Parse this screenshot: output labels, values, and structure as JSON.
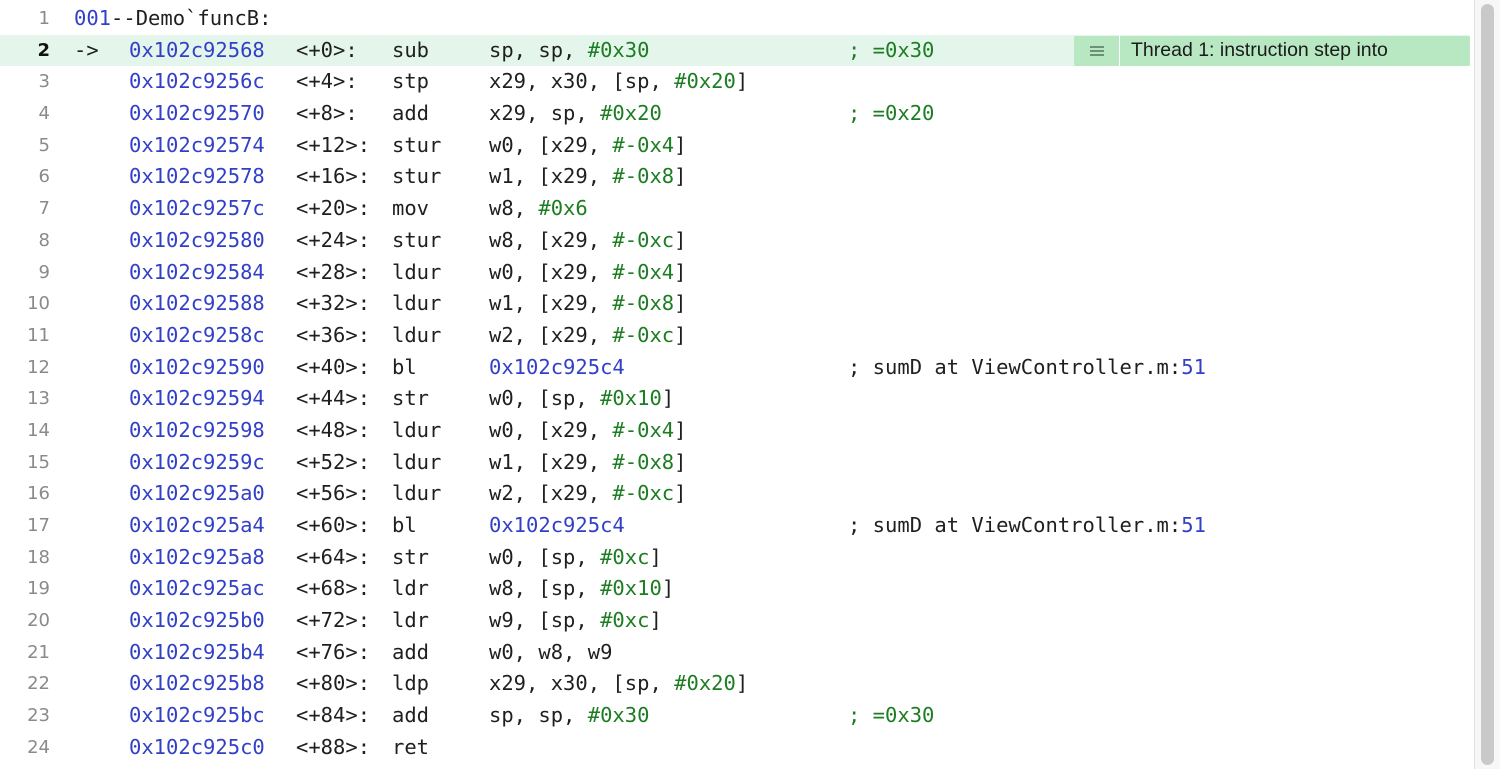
{
  "header": {
    "func_num": "001",
    "func_rest": "--Demo`funcB:"
  },
  "badge": {
    "icon": "list-lines-icon",
    "text": "Thread 1: instruction step into"
  },
  "pc_arrow": "->",
  "lines": [
    {
      "n": "1"
    },
    {
      "n": "2",
      "addr": "0x102c92568",
      "off": "<+0>:",
      "mn": "sub",
      "ops": [
        {
          "t": "sp, sp, "
        },
        {
          "t": "#0x30",
          "c": "num"
        }
      ],
      "cmt": "; =0x30"
    },
    {
      "n": "3",
      "addr": "0x102c9256c",
      "off": "<+4>:",
      "mn": "stp",
      "ops": [
        {
          "t": "x29, x30, [sp, "
        },
        {
          "t": "#0x20",
          "c": "num"
        },
        {
          "t": "]"
        }
      ]
    },
    {
      "n": "4",
      "addr": "0x102c92570",
      "off": "<+8>:",
      "mn": "add",
      "ops": [
        {
          "t": "x29, sp, "
        },
        {
          "t": "#0x20",
          "c": "num"
        }
      ],
      "cmt": "; =0x20"
    },
    {
      "n": "5",
      "addr": "0x102c92574",
      "off": "<+12>:",
      "mn": "stur",
      "ops": [
        {
          "t": "w0, [x29, "
        },
        {
          "t": "#-0x4",
          "c": "num"
        },
        {
          "t": "]"
        }
      ]
    },
    {
      "n": "6",
      "addr": "0x102c92578",
      "off": "<+16>:",
      "mn": "stur",
      "ops": [
        {
          "t": "w1, [x29, "
        },
        {
          "t": "#-0x8",
          "c": "num"
        },
        {
          "t": "]"
        }
      ]
    },
    {
      "n": "7",
      "addr": "0x102c9257c",
      "off": "<+20>:",
      "mn": "mov",
      "ops": [
        {
          "t": "w8, "
        },
        {
          "t": "#0x6",
          "c": "num"
        }
      ]
    },
    {
      "n": "8",
      "addr": "0x102c92580",
      "off": "<+24>:",
      "mn": "stur",
      "ops": [
        {
          "t": "w8, [x29, "
        },
        {
          "t": "#-0xc",
          "c": "num"
        },
        {
          "t": "]"
        }
      ]
    },
    {
      "n": "9",
      "addr": "0x102c92584",
      "off": "<+28>:",
      "mn": "ldur",
      "ops": [
        {
          "t": "w0, [x29, "
        },
        {
          "t": "#-0x4",
          "c": "num"
        },
        {
          "t": "]"
        }
      ]
    },
    {
      "n": "10",
      "addr": "0x102c92588",
      "off": "<+32>:",
      "mn": "ldur",
      "ops": [
        {
          "t": "w1, [x29, "
        },
        {
          "t": "#-0x8",
          "c": "num"
        },
        {
          "t": "]"
        }
      ]
    },
    {
      "n": "11",
      "addr": "0x102c9258c",
      "off": "<+36>:",
      "mn": "ldur",
      "ops": [
        {
          "t": "w2, [x29, "
        },
        {
          "t": "#-0xc",
          "c": "num"
        },
        {
          "t": "]"
        }
      ]
    },
    {
      "n": "12",
      "addr": "0x102c92590",
      "off": "<+40>:",
      "mn": "bl",
      "ops": [
        {
          "t": "0x102c925c4",
          "c": "lnk"
        }
      ],
      "sym": "; sumD at ViewController.m:",
      "symline": "51"
    },
    {
      "n": "13",
      "addr": "0x102c92594",
      "off": "<+44>:",
      "mn": "str",
      "ops": [
        {
          "t": "w0, [sp, "
        },
        {
          "t": "#0x10",
          "c": "num"
        },
        {
          "t": "]"
        }
      ]
    },
    {
      "n": "14",
      "addr": "0x102c92598",
      "off": "<+48>:",
      "mn": "ldur",
      "ops": [
        {
          "t": "w0, [x29, "
        },
        {
          "t": "#-0x4",
          "c": "num"
        },
        {
          "t": "]"
        }
      ]
    },
    {
      "n": "15",
      "addr": "0x102c9259c",
      "off": "<+52>:",
      "mn": "ldur",
      "ops": [
        {
          "t": "w1, [x29, "
        },
        {
          "t": "#-0x8",
          "c": "num"
        },
        {
          "t": "]"
        }
      ]
    },
    {
      "n": "16",
      "addr": "0x102c925a0",
      "off": "<+56>:",
      "mn": "ldur",
      "ops": [
        {
          "t": "w2, [x29, "
        },
        {
          "t": "#-0xc",
          "c": "num"
        },
        {
          "t": "]"
        }
      ]
    },
    {
      "n": "17",
      "addr": "0x102c925a4",
      "off": "<+60>:",
      "mn": "bl",
      "ops": [
        {
          "t": "0x102c925c4",
          "c": "lnk"
        }
      ],
      "sym": "; sumD at ViewController.m:",
      "symline": "51"
    },
    {
      "n": "18",
      "addr": "0x102c925a8",
      "off": "<+64>:",
      "mn": "str",
      "ops": [
        {
          "t": "w0, [sp, "
        },
        {
          "t": "#0xc",
          "c": "num"
        },
        {
          "t": "]"
        }
      ]
    },
    {
      "n": "19",
      "addr": "0x102c925ac",
      "off": "<+68>:",
      "mn": "ldr",
      "ops": [
        {
          "t": "w8, [sp, "
        },
        {
          "t": "#0x10",
          "c": "num"
        },
        {
          "t": "]"
        }
      ]
    },
    {
      "n": "20",
      "addr": "0x102c925b0",
      "off": "<+72>:",
      "mn": "ldr",
      "ops": [
        {
          "t": "w9, [sp, "
        },
        {
          "t": "#0xc",
          "c": "num"
        },
        {
          "t": "]"
        }
      ]
    },
    {
      "n": "21",
      "addr": "0x102c925b4",
      "off": "<+76>:",
      "mn": "add",
      "ops": [
        {
          "t": "w0, w8, w9"
        }
      ]
    },
    {
      "n": "22",
      "addr": "0x102c925b8",
      "off": "<+80>:",
      "mn": "ldp",
      "ops": [
        {
          "t": "x29, x30, [sp, "
        },
        {
          "t": "#0x20",
          "c": "num"
        },
        {
          "t": "]"
        }
      ]
    },
    {
      "n": "23",
      "addr": "0x102c925bc",
      "off": "<+84>:",
      "mn": "add",
      "ops": [
        {
          "t": "sp, sp, "
        },
        {
          "t": "#0x30",
          "c": "num"
        }
      ],
      "cmt": "; =0x30"
    },
    {
      "n": "24",
      "addr": "0x102c925c0",
      "off": "<+88>:",
      "mn": "ret"
    }
  ],
  "colors": {
    "address": "#3240c7",
    "immediate": "#1c7d21",
    "comment": "#1c7d21",
    "current_line_bg": "#e4f6ec",
    "badge_bg": "#b7e8c2"
  }
}
